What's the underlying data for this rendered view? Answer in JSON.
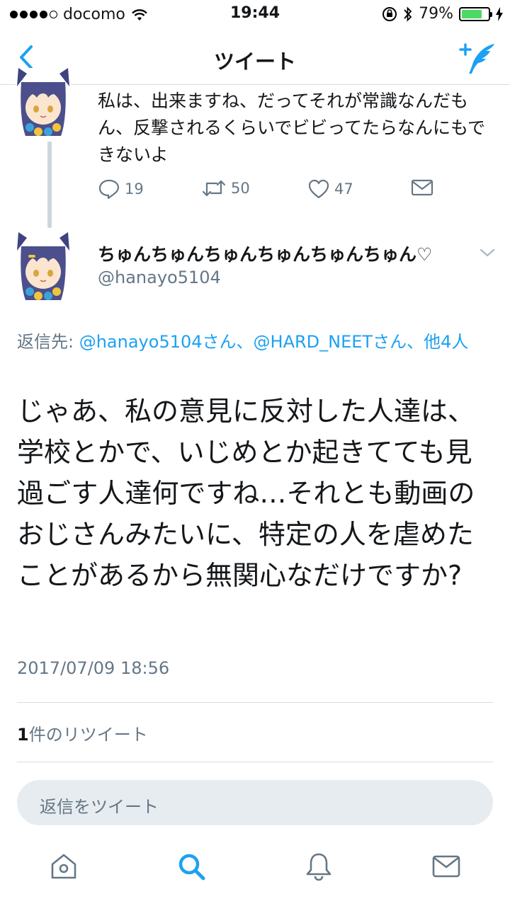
{
  "status_bar": {
    "carrier": "docomo",
    "time": "19:44",
    "battery": "79%",
    "battery_level": 0.79
  },
  "nav": {
    "title": "ツイート",
    "back_icon": "chevron-left-icon",
    "compose_icon": "compose-tweet-icon"
  },
  "previous_tweet": {
    "text": "私は、出来ますね、だってそれが常識なんだもん、反撃されるくらいでビビってたらなんにもできないよ",
    "replies": "19",
    "retweets": "50",
    "likes": "47"
  },
  "tweet": {
    "display_name": "ちゅんちゅんちゅんちゅんちゅんちゅん♡",
    "handle": "@hanayo5104",
    "reply_prefix": "返信先: ",
    "reply_user1": "@hanayo5104さん",
    "reply_sep": "、",
    "reply_user2": "@HARD_NEETさん",
    "reply_others": "、他4人",
    "text": "じゃあ、私の意見に反対した人達は、学校とかで、いじめとか起きてても見過ごす人達何ですね…それとも動画のおじさんみたいに、特定の人を虐めたことがあるから無関心なだけですか?",
    "timestamp": "2017/07/09 18:56",
    "retweet_count": "1",
    "retweet_label": "件のリツイート"
  },
  "reply_bar": {
    "placeholder": "返信をツイート"
  },
  "tabs": [
    "home-icon",
    "search-icon",
    "notifications-icon",
    "messages-icon"
  ],
  "colors": {
    "accent": "#1da1f2",
    "secondary_text": "#657786",
    "primary_text": "#14171a"
  }
}
